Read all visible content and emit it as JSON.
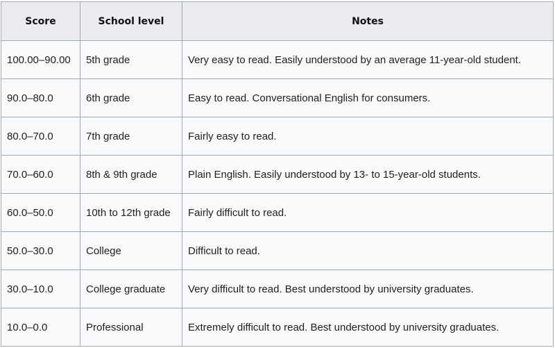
{
  "table": {
    "headers": {
      "score": "Score",
      "school_level": "School level",
      "notes": "Notes"
    },
    "rows": [
      {
        "score": "100.00–90.00",
        "school_level": "5th grade",
        "notes": "Very easy to read. Easily understood by an average 11-year-old student."
      },
      {
        "score": "90.0–80.0",
        "school_level": "6th grade",
        "notes": "Easy to read. Conversational English for consumers."
      },
      {
        "score": "80.0–70.0",
        "school_level": "7th grade",
        "notes": "Fairly easy to read."
      },
      {
        "score": "70.0–60.0",
        "school_level": "8th & 9th grade",
        "notes": "Plain English. Easily understood by 13- to 15-year-old students."
      },
      {
        "score": "60.0–50.0",
        "school_level": "10th to 12th grade",
        "notes": "Fairly difficult to read."
      },
      {
        "score": "50.0–30.0",
        "school_level": "College",
        "notes": "Difficult to read."
      },
      {
        "score": "30.0–10.0",
        "school_level": "College graduate",
        "notes": "Very difficult to read. Best understood by university graduates."
      },
      {
        "score": "10.0–0.0",
        "school_level": "Professional",
        "notes": "Extremely difficult to read. Best understood by university graduates."
      }
    ]
  },
  "colors": {
    "header_background": "#eaecf0",
    "body_background": "#f8f9fa",
    "border": "#a2a9b1",
    "text": "#202122"
  }
}
